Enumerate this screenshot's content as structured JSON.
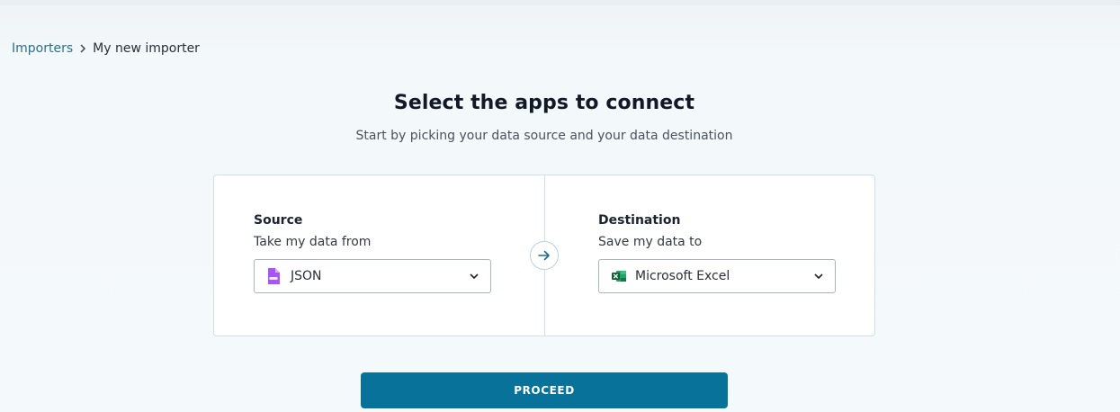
{
  "breadcrumb": {
    "parent": "Importers",
    "current": "My new importer"
  },
  "header": {
    "title": "Select the apps to connect",
    "subtitle": "Start by picking your data source and your data destination"
  },
  "source": {
    "title": "Source",
    "subtitle": "Take my data from",
    "selected": "JSON",
    "icon": "json-file-icon",
    "icon_color": "#a855f7"
  },
  "destination": {
    "title": "Destination",
    "subtitle": "Save my data to",
    "selected": "Microsoft Excel",
    "icon": "excel-icon",
    "icon_color": "#1d7044"
  },
  "actions": {
    "proceed_label": "PROCEED"
  },
  "colors": {
    "accent": "#08729a",
    "link": "#2c6f8c",
    "background": "#f4f9fb"
  }
}
